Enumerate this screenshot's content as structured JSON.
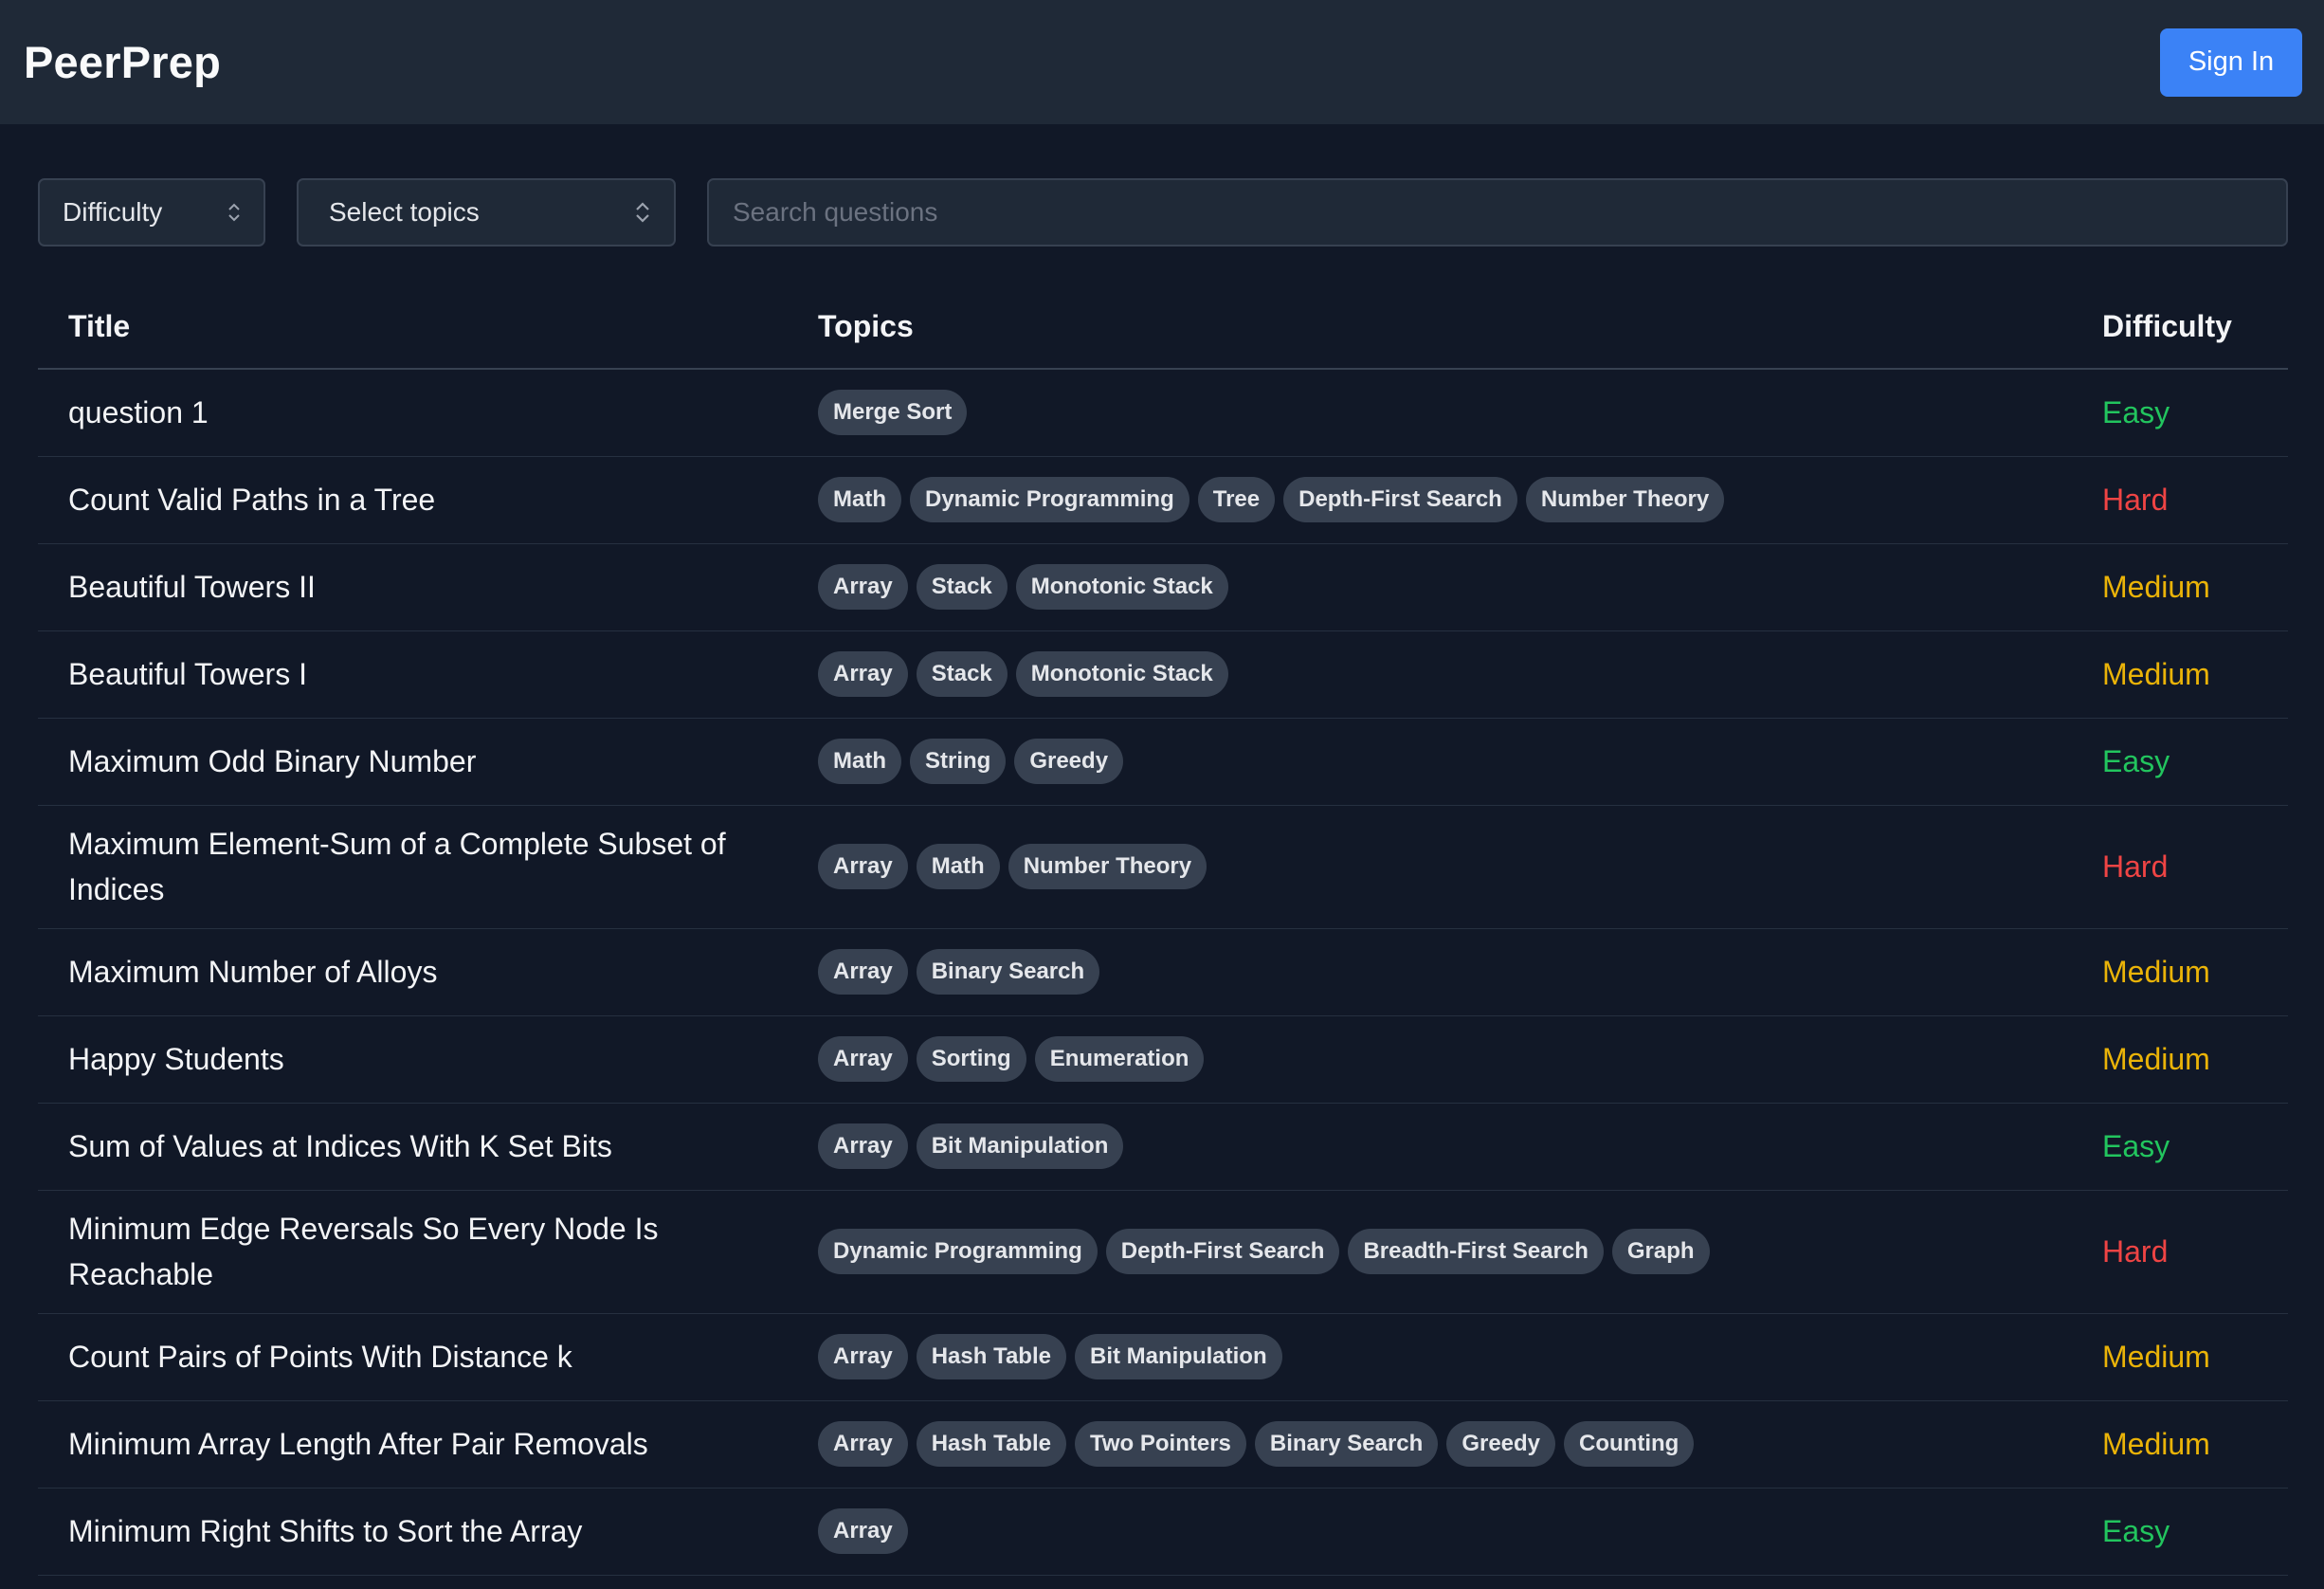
{
  "app": {
    "title": "PeerPrep",
    "sign_in": "Sign In"
  },
  "filters": {
    "difficulty_label": "Difficulty",
    "topics_label": "Select topics",
    "search_placeholder": "Search questions"
  },
  "table": {
    "headers": {
      "title": "Title",
      "topics": "Topics",
      "difficulty": "Difficulty"
    },
    "rows": [
      {
        "title": "question 1",
        "topics": [
          "Merge Sort"
        ],
        "difficulty": "Easy"
      },
      {
        "title": "Count Valid Paths in a Tree",
        "topics": [
          "Math",
          "Dynamic Programming",
          "Tree",
          "Depth-First Search",
          "Number Theory"
        ],
        "difficulty": "Hard"
      },
      {
        "title": "Beautiful Towers II",
        "topics": [
          "Array",
          "Stack",
          "Monotonic Stack"
        ],
        "difficulty": "Medium"
      },
      {
        "title": "Beautiful Towers I",
        "topics": [
          "Array",
          "Stack",
          "Monotonic Stack"
        ],
        "difficulty": "Medium"
      },
      {
        "title": "Maximum Odd Binary Number",
        "topics": [
          "Math",
          "String",
          "Greedy"
        ],
        "difficulty": "Easy"
      },
      {
        "title": "Maximum Element-Sum of a Complete Subset of Indices",
        "topics": [
          "Array",
          "Math",
          "Number Theory"
        ],
        "difficulty": "Hard"
      },
      {
        "title": "Maximum Number of Alloys",
        "topics": [
          "Array",
          "Binary Search"
        ],
        "difficulty": "Medium"
      },
      {
        "title": "Happy Students",
        "topics": [
          "Array",
          "Sorting",
          "Enumeration"
        ],
        "difficulty": "Medium"
      },
      {
        "title": "Sum of Values at Indices With K Set Bits",
        "topics": [
          "Array",
          "Bit Manipulation"
        ],
        "difficulty": "Easy"
      },
      {
        "title": "Minimum Edge Reversals So Every Node Is Reachable",
        "topics": [
          "Dynamic Programming",
          "Depth-First Search",
          "Breadth-First Search",
          "Graph"
        ],
        "difficulty": "Hard"
      },
      {
        "title": "Count Pairs of Points With Distance k",
        "topics": [
          "Array",
          "Hash Table",
          "Bit Manipulation"
        ],
        "difficulty": "Medium"
      },
      {
        "title": "Minimum Array Length After Pair Removals",
        "topics": [
          "Array",
          "Hash Table",
          "Two Pointers",
          "Binary Search",
          "Greedy",
          "Counting"
        ],
        "difficulty": "Medium"
      },
      {
        "title": "Minimum Right Shifts to Sort the Array",
        "topics": [
          "Array"
        ],
        "difficulty": "Easy"
      }
    ]
  },
  "colors": {
    "background": "#111827",
    "header": "#1f2937",
    "accent": "#3b82f6",
    "easy": "#22c55e",
    "medium": "#eab308",
    "hard": "#ef4444",
    "tag": "#374151"
  },
  "icons": {
    "select_indicator": "chevron-up-down-icon"
  }
}
